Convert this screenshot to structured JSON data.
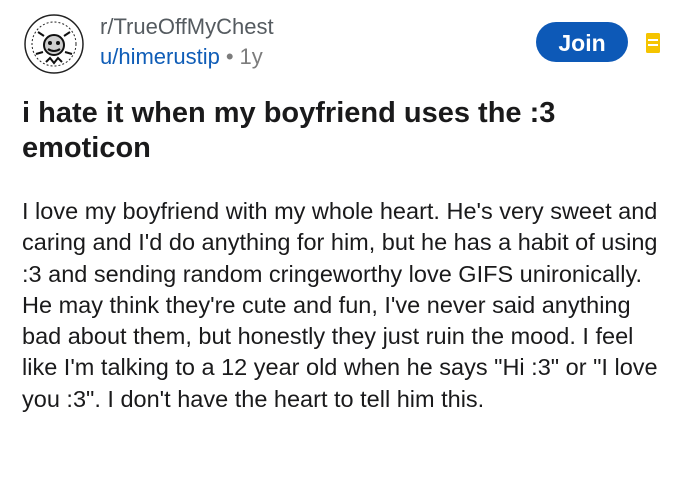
{
  "header": {
    "subreddit": "r/TrueOffMyChest",
    "author": "u/himerustip",
    "separator": "•",
    "age": "1y",
    "join_label": "Join",
    "avatar_icon": "subreddit-avatar-icon",
    "tag_icon": "bookmark-icon",
    "accent_color": "#0d59b7",
    "tag_color": "#f5c400"
  },
  "post": {
    "title": "i hate it when my boyfriend uses the :3 emoticon",
    "body": "I love my boyfriend with my whole heart. He's very sweet and caring and I'd do anything for him, but he has a habit of using :3 and sending random cringeworthy love GIFS unironically. He may think they're cute and fun, I've never said anything bad about them, but honestly they just ruin the mood. I feel like I'm talking to a 12 year old when he says \"Hi :3\" or \"I love you :3\". I don't have the heart to tell him this."
  }
}
